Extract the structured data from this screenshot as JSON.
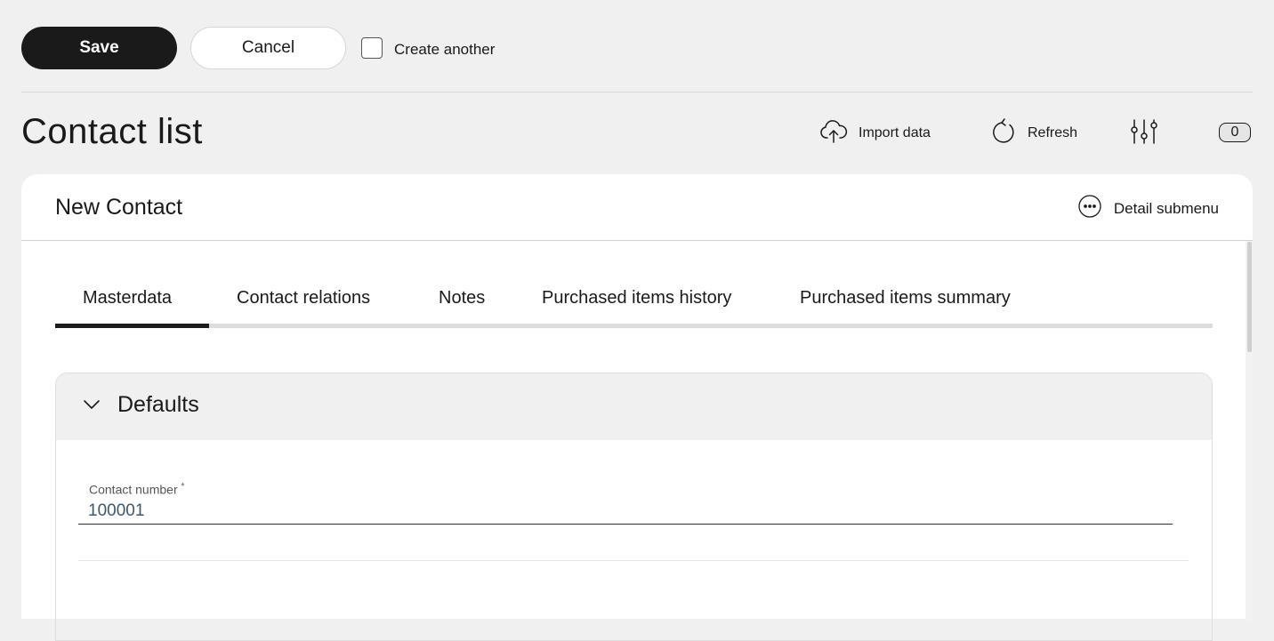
{
  "toolbar": {
    "save_label": "Save",
    "cancel_label": "Cancel",
    "create_another_label": "Create another",
    "create_another_checked": false
  },
  "header": {
    "title": "Contact list",
    "actions": {
      "import_label": "Import data",
      "refresh_label": "Refresh",
      "filter_icon": "sliders-icon",
      "badge_count": "0"
    }
  },
  "card": {
    "title": "New Contact",
    "submenu_label": "Detail submenu",
    "tabs": [
      {
        "label": "Masterdata",
        "active": true
      },
      {
        "label": "Contact relations",
        "active": false
      },
      {
        "label": "Notes",
        "active": false
      },
      {
        "label": "Purchased items history",
        "active": false
      },
      {
        "label": "Purchased items summary",
        "active": false
      }
    ],
    "section": {
      "title": "Defaults",
      "expanded": true,
      "fields": {
        "contact_number": {
          "label": "Contact number",
          "required_mark": "*",
          "value": "100001"
        }
      }
    }
  },
  "colors": {
    "primary": "#1a1a1a",
    "background": "#f0f0f0",
    "surface": "#ffffff",
    "input_text": "#40566a"
  }
}
